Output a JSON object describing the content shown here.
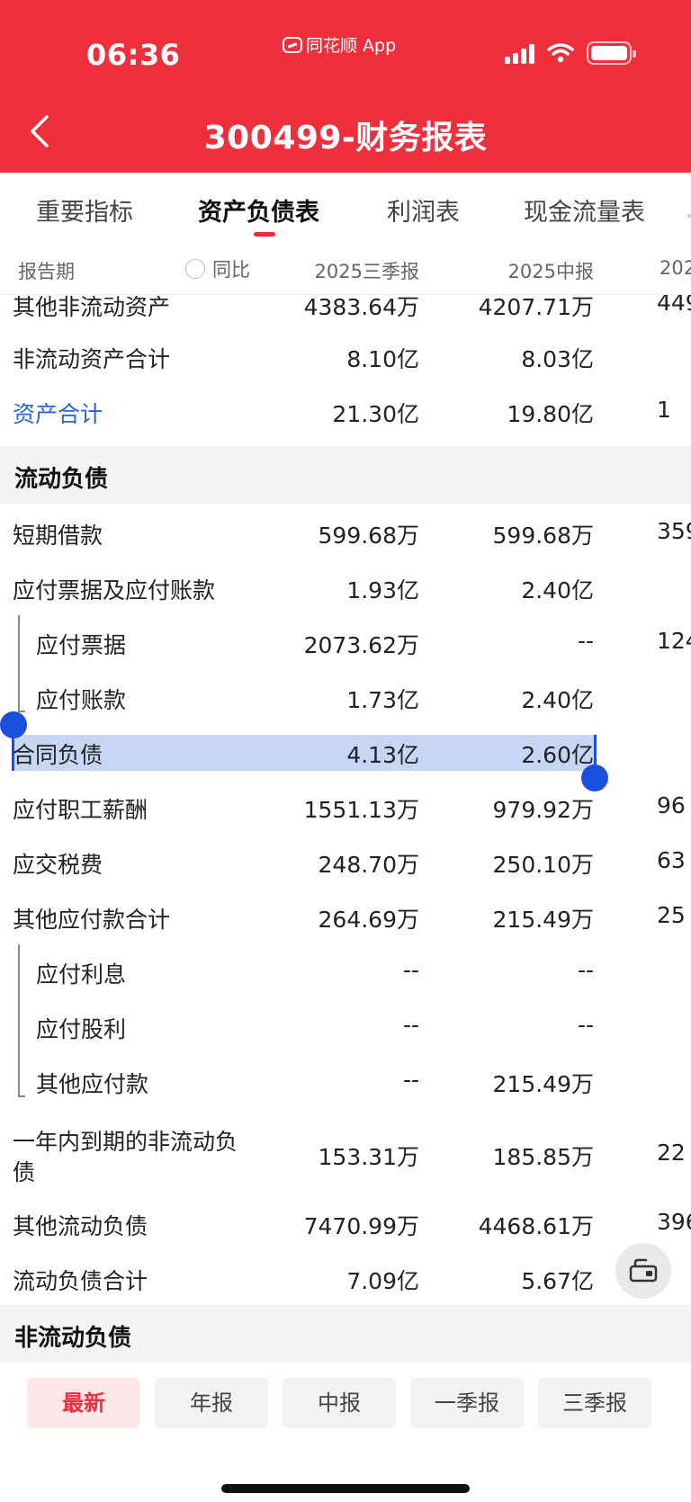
{
  "status_bar": {
    "time": "06:36",
    "app_name": "同花顺 App"
  },
  "header": {
    "title": "300499-财务报表"
  },
  "tabs": [
    {
      "label": "重要指标",
      "active": false
    },
    {
      "label": "资产负债表",
      "active": true
    },
    {
      "label": "利润表",
      "active": false
    },
    {
      "label": "现金流量表",
      "active": false
    }
  ],
  "columns": {
    "label": "报告期",
    "yoy": "同比",
    "col1": "2025三季报",
    "col2": "2025中报",
    "col3": "202"
  },
  "rows": [
    {
      "name": "其他非流动资产",
      "v1": "4383.64万",
      "v2": "4207.71万",
      "v3": "449"
    },
    {
      "name": "非流动资产合计",
      "v1": "8.10亿",
      "v2": "8.03亿",
      "v3": ""
    },
    {
      "name": "资产合计",
      "v1": "21.30亿",
      "v2": "19.80亿",
      "v3": "1"
    },
    {
      "name": "短期借款",
      "v1": "599.68万",
      "v2": "599.68万",
      "v3": "359"
    },
    {
      "name": "应付票据及应付账款",
      "v1": "1.93亿",
      "v2": "2.40亿",
      "v3": ""
    },
    {
      "name": "应付票据",
      "v1": "2073.62万",
      "v2": "--",
      "v3": "124"
    },
    {
      "name": "应付账款",
      "v1": "1.73亿",
      "v2": "2.40亿",
      "v3": ""
    },
    {
      "name": "合同负债",
      "v1": "4.13亿",
      "v2": "2.60亿",
      "v3": ""
    },
    {
      "name": "应付职工薪酬",
      "v1": "1551.13万",
      "v2": "979.92万",
      "v3": "96"
    },
    {
      "name": "应交税费",
      "v1": "248.70万",
      "v2": "250.10万",
      "v3": "63"
    },
    {
      "name": "其他应付款合计",
      "v1": "264.69万",
      "v2": "215.49万",
      "v3": "25"
    },
    {
      "name": "应付利息",
      "v1": "--",
      "v2": "--",
      "v3": ""
    },
    {
      "name": "应付股利",
      "v1": "--",
      "v2": "--",
      "v3": ""
    },
    {
      "name": "其他应付款",
      "v1": "--",
      "v2": "215.49万",
      "v3": ""
    },
    {
      "name_line1": "一年内到期的非流动负",
      "name_line2": "债",
      "v1": "153.31万",
      "v2": "185.85万",
      "v3": "22"
    },
    {
      "name": "其他流动负债",
      "v1": "7470.99万",
      "v2": "4468.61万",
      "v3": "396"
    },
    {
      "name": "流动负债合计",
      "v1": "7.09亿",
      "v2": "5.67亿",
      "v3": ""
    }
  ],
  "sections": {
    "current_liabilities": "流动负债",
    "noncurrent_liabilities": "非流动负债"
  },
  "period_buttons": [
    {
      "label": "最新",
      "active": true
    },
    {
      "label": "年报",
      "active": false
    },
    {
      "label": "中报",
      "active": false
    },
    {
      "label": "一季报",
      "active": false
    },
    {
      "label": "三季报",
      "active": false
    }
  ],
  "colors": {
    "brand_red": "#ef2f3b",
    "link_blue": "#2f62d6",
    "selection": "#c7d6f5",
    "handle_blue": "#1a4fe0"
  }
}
